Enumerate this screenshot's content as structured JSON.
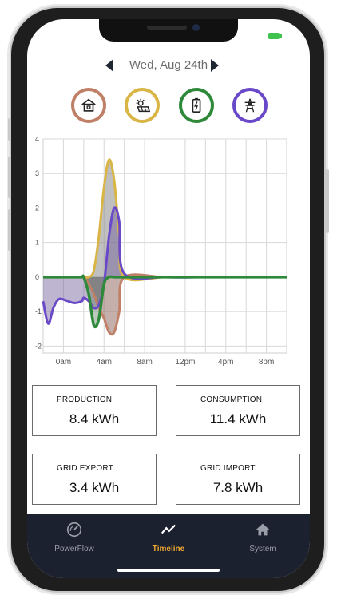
{
  "header": {
    "date": "Wed, Aug 24th"
  },
  "filters": [
    {
      "name": "home",
      "color": "#c08068"
    },
    {
      "name": "solar",
      "color": "#d9b545"
    },
    {
      "name": "battery",
      "color": "#2e8a3a"
    },
    {
      "name": "grid",
      "color": "#6a49c9"
    }
  ],
  "chart_data": {
    "type": "area",
    "x_ticks": [
      "0am",
      "4am",
      "8am",
      "12pm",
      "4pm",
      "8pm"
    ],
    "y_ticks": [
      "4",
      "3",
      "2",
      "1",
      "0",
      "-1",
      "-2"
    ],
    "ylim": [
      -2.2,
      4
    ],
    "x_hours": [
      0,
      0.5,
      1,
      1.5,
      2,
      3,
      3.8,
      4,
      4.5,
      5,
      5.5,
      6,
      6.5,
      7,
      7.5,
      8,
      12,
      16,
      20,
      24
    ],
    "series": [
      {
        "color": "#d9b545",
        "values": [
          0,
          0,
          0,
          0,
          0,
          0,
          0,
          0,
          0,
          0.2,
          1.2,
          2.6,
          3.4,
          2.8,
          1.2,
          0,
          0,
          0,
          0,
          0
        ]
      },
      {
        "color": "#c08068",
        "values": [
          0,
          0,
          0,
          0,
          0,
          0,
          0,
          0,
          -0.2,
          -0.5,
          -0.9,
          -1.2,
          -1.6,
          -1.6,
          -1.0,
          0,
          0,
          0,
          0,
          0
        ]
      },
      {
        "color": "#6a49c9",
        "values": [
          -0.7,
          -1.35,
          -0.9,
          -0.65,
          -0.65,
          -0.75,
          -0.7,
          -0.6,
          -0.7,
          -0.9,
          -0.8,
          -0.2,
          1.2,
          2.0,
          1.6,
          0.1,
          0,
          0,
          0,
          0
        ]
      },
      {
        "color": "#2e8a3a",
        "values": [
          0,
          0,
          0,
          0,
          0,
          0,
          0,
          0,
          -0.5,
          -1.4,
          -1.2,
          -0.2,
          0,
          0,
          0,
          0,
          0,
          0,
          0,
          0
        ]
      }
    ],
    "grid": true
  },
  "stats": [
    {
      "label": "PRODUCTION",
      "value": "8.4 kWh"
    },
    {
      "label": "CONSUMPTION",
      "value": "11.4 kWh"
    },
    {
      "label": "GRID EXPORT",
      "value": "3.4 kWh"
    },
    {
      "label": "GRID IMPORT",
      "value": "7.8 kWh"
    }
  ],
  "tabs": [
    {
      "label": "PowerFlow",
      "icon": "gauge-icon",
      "color": "#9a9ea8"
    },
    {
      "label": "Timeline",
      "icon": "chart-line-icon",
      "color": "#f0a830"
    },
    {
      "label": "System",
      "icon": "house-icon",
      "color": "#9a9ea8"
    }
  ]
}
